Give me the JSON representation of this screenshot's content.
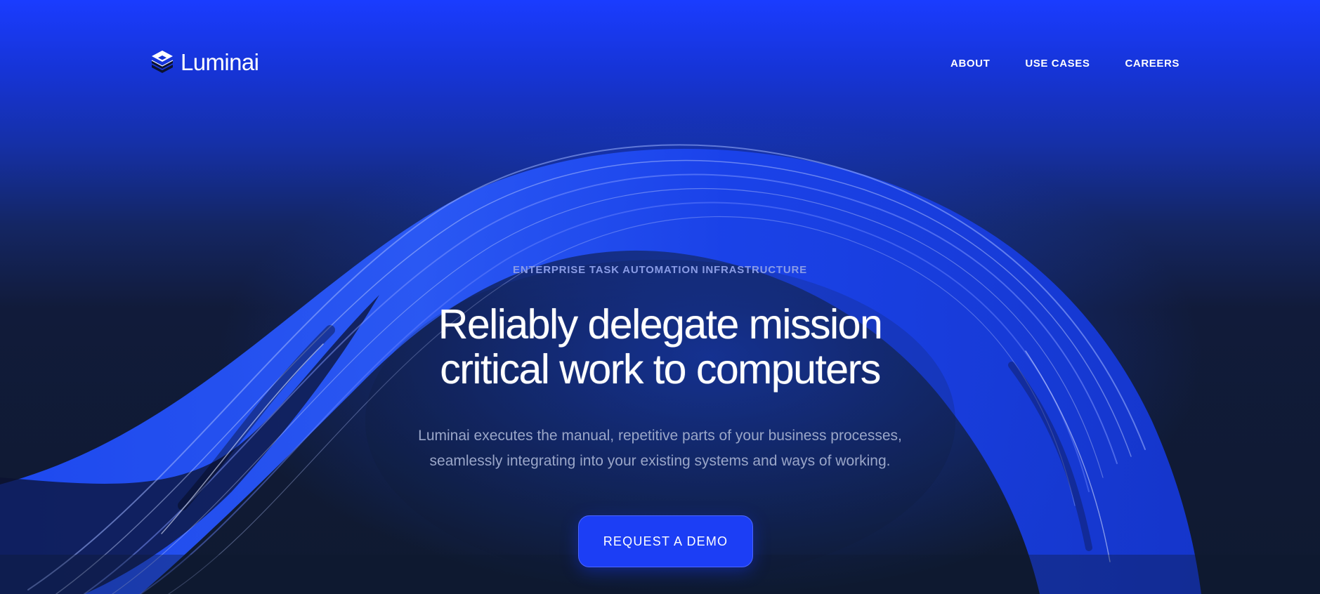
{
  "brand": {
    "name": "Luminai",
    "logo_icon": "stacked-layers-icon"
  },
  "nav": {
    "links": [
      {
        "label": "ABOUT"
      },
      {
        "label": "USE CASES"
      },
      {
        "label": "CAREERS"
      }
    ]
  },
  "hero": {
    "eyebrow": "ENTERPRISE TASK AUTOMATION INFRASTRUCTURE",
    "headline_line1": "Reliably delegate mission",
    "headline_line2": "critical work to computers",
    "subtitle_line1": "Luminai executes the manual, repetitive parts of your business processes,",
    "subtitle_line2": "seamlessly integrating into your existing systems and ways of working.",
    "cta_label": "REQUEST A DEMO"
  },
  "colors": {
    "brand_blue": "#1c3ef5",
    "background_dark": "#0f1a30",
    "eyebrow_text": "#8a9ce6",
    "subtitle_text": "#9aa6c8"
  }
}
